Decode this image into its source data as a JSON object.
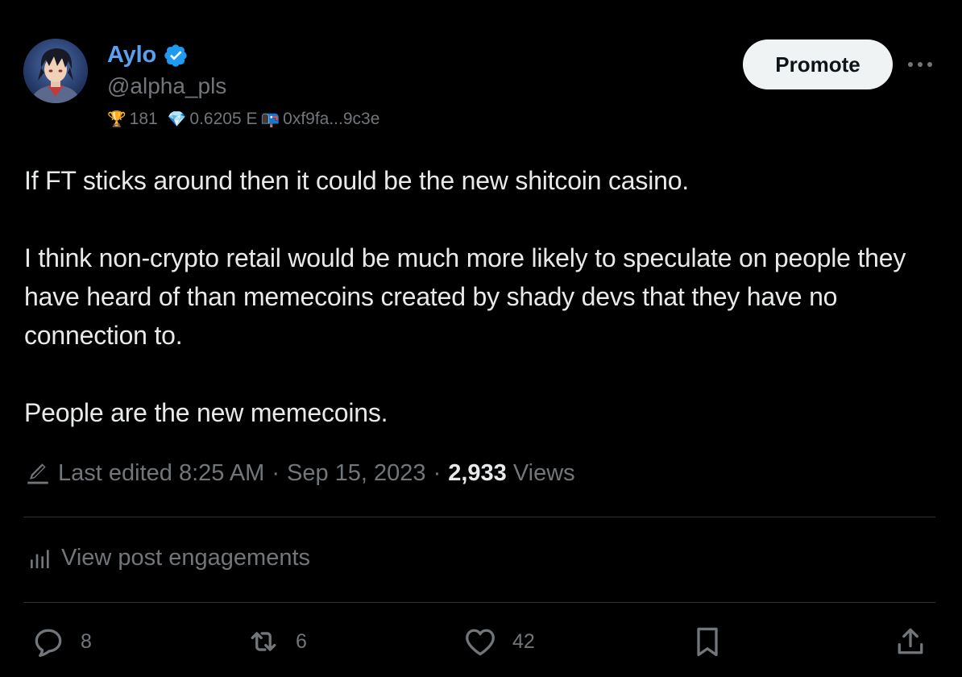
{
  "author": {
    "display_name": "Aylo",
    "handle": "@alpha_pls",
    "verified": true,
    "avatar_icon": "anime-avatar"
  },
  "profile_stats": {
    "trophy_icon": "🏆",
    "trophy_count": "181",
    "diamond_icon": "💎",
    "eth_value": "0.6205 E",
    "wallet_icon": "📭",
    "wallet_address": "0xf9fa...9c3e"
  },
  "header": {
    "promote_label": "Promote",
    "more_label": "···"
  },
  "tweet": {
    "paragraphs": [
      "If FT sticks around then it could be the new shitcoin casino.",
      "I think non-crypto retail would be much more likely to speculate on people they have heard of than memecoins created by shady devs that they have no connection to.",
      "People are the new memecoins."
    ]
  },
  "meta": {
    "edited_label": "Last edited 8:25 AM",
    "separator": "·",
    "date": "Sep 15, 2023",
    "views_count": "2,933",
    "views_label": "Views"
  },
  "engagements": {
    "label": "View post engagements"
  },
  "actions": {
    "replies": "8",
    "reposts": "6",
    "likes": "42"
  },
  "colors": {
    "background": "#000000",
    "text": "#e7e9ea",
    "secondary": "#71767b",
    "accent": "#1d9bf0",
    "name": "#5aa0f2",
    "divider": "#2f3336"
  }
}
